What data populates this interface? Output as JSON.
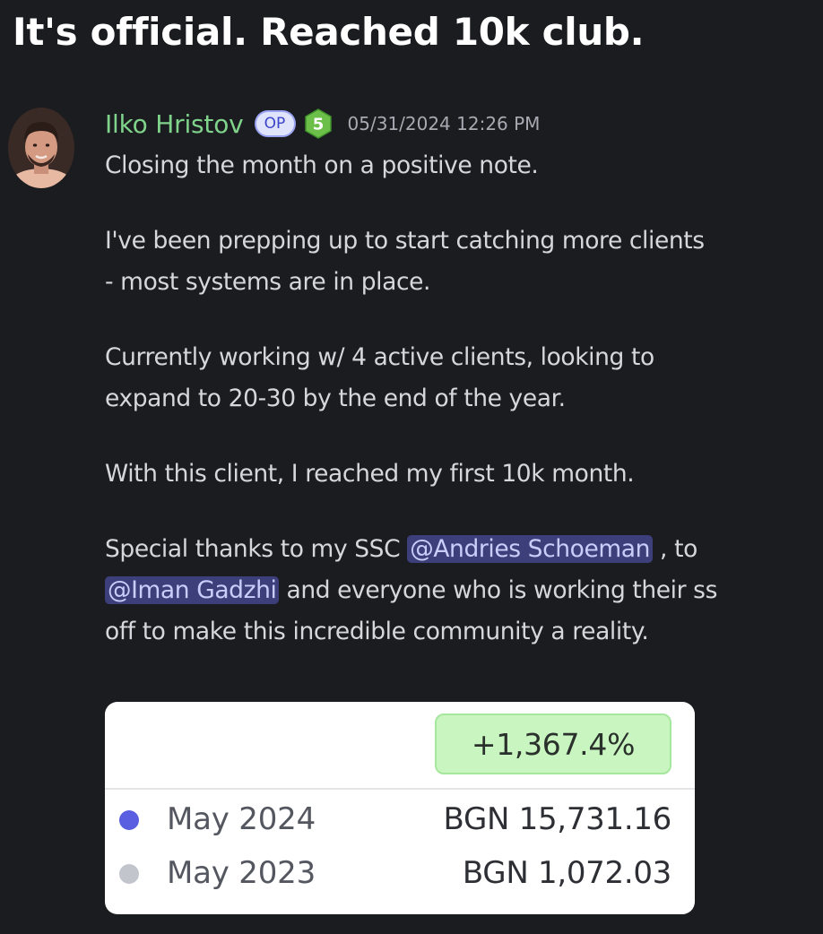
{
  "headline": "It's official. Reached 10k club.",
  "message": {
    "author": "Ilko Hristov",
    "op_badge": "OP",
    "level_badge": "5",
    "timestamp": "05/31/2024 12:26 PM",
    "paragraphs": [
      "Closing the month on a positive note.",
      "I've been prepping up to start catching more clients",
      "- most systems are in place.",
      "Currently working w/ 4 active clients, looking to",
      "expand to 20-30 by the end of the year.",
      "With this client, I reached my first 10k month."
    ],
    "thanks": {
      "prefix": "Special thanks to my SSC ",
      "mention1": "@Andries Schoeman",
      "middle": " , to",
      "mention2": "@Iman Gadzhi",
      "line2_rest": " and everyone who is working their ss",
      "line3": "off to make this incredible community a reality."
    }
  },
  "card": {
    "growth": "+1,367.4%",
    "rows": [
      {
        "label": "May 2024",
        "amount": "BGN 15,731.16",
        "dot_color": "#5a5ee0"
      },
      {
        "label": "May 2023",
        "amount": "BGN 1,072.03",
        "dot_color": "#c3c5cc"
      }
    ]
  },
  "colors": {
    "background": "#1b1c20",
    "author": "#7fd38b",
    "mention_bg": "#3c3f7a",
    "growth_bg": "#c9f6c0"
  }
}
